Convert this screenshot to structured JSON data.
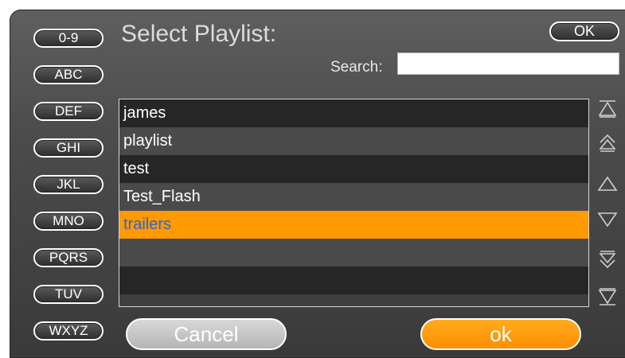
{
  "dialog": {
    "title": "Select Playlist:",
    "ok_top_label": "OK",
    "search": {
      "label": "Search:",
      "value": "",
      "placeholder": ""
    }
  },
  "letter_buttons": [
    "0-9",
    "ABC",
    "DEF",
    "GHI",
    "JKL",
    "MNO",
    "PQRS",
    "TUV",
    "WXYZ"
  ],
  "playlist": {
    "items": [
      "james",
      "playlist",
      "test",
      "Test_Flash",
      "trailers",
      "",
      ""
    ],
    "selected": "trailers"
  },
  "nav_icons": [
    "scroll-top-icon",
    "page-up-icon",
    "line-up-icon",
    "line-down-icon",
    "page-down-icon",
    "scroll-bottom-icon"
  ],
  "footer": {
    "cancel_label": "Cancel",
    "ok_label": "ok"
  },
  "colors": {
    "selection": "#ff9a00",
    "selected_text": "#2f63d6",
    "row_dark": "#262626",
    "row_light": "#4a4a4a"
  }
}
